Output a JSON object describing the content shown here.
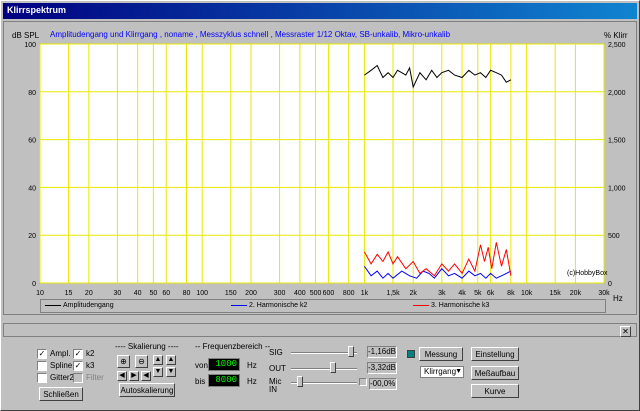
{
  "window": {
    "title": "Klirrspektrum"
  },
  "plot": {
    "subtitle": "Amplitudengang und Klirrgang , noname , Messzyklus schnell , Messraster 1/12 Oktav, SB-unkalib, Mikro-unkalib",
    "left_unit": "dB SPL",
    "right_unit": "% Klirr",
    "x_unit": "Hz",
    "watermark": "(c)HobbyBox"
  },
  "chart_data": {
    "type": "line",
    "xscale": "log",
    "xlim": [
      10,
      30000
    ],
    "ylim_left": [
      0,
      100
    ],
    "ylim_right": [
      0,
      2500
    ],
    "grid": true,
    "x_ticks": [
      "10",
      "15",
      "20",
      "30",
      "40",
      "50",
      "60",
      "80",
      "100",
      "150",
      "200",
      "300",
      "400",
      "500",
      "600",
      "800",
      "1k",
      "1,5k",
      "2k",
      "3k",
      "4k",
      "5k",
      "6k",
      "8k",
      "10k",
      "15k",
      "20k",
      "30k"
    ],
    "y_left_ticks": [
      "0",
      "20",
      "40",
      "60",
      "80",
      "100"
    ],
    "y_right_ticks": [
      "0",
      "500",
      "1,000",
      "1,500",
      "2,000",
      "2,500"
    ],
    "series": [
      {
        "name": "Amplitudengang",
        "color": "#000000",
        "x": [
          1000,
          1100,
          1200,
          1300,
          1400,
          1500,
          1600,
          1700,
          1800,
          1900,
          2000,
          2200,
          2400,
          2600,
          2800,
          3000,
          3300,
          3600,
          4000,
          4400,
          4800,
          5200,
          5600,
          6000,
          6500,
          7000,
          7500,
          8000
        ],
        "y": [
          87,
          89,
          91,
          86,
          88,
          86,
          89,
          88,
          87,
          90,
          82,
          88,
          85,
          89,
          86,
          88,
          89,
          87,
          86,
          89,
          87,
          88,
          86,
          89,
          88,
          87,
          84,
          85
        ]
      },
      {
        "name": "2. Harmonische k2",
        "color": "#0000ff",
        "x": [
          1000,
          1100,
          1200,
          1300,
          1400,
          1500,
          1700,
          1900,
          2100,
          2300,
          2500,
          2700,
          3000,
          3300,
          3600,
          4000,
          4400,
          4800,
          5200,
          5600,
          6000,
          6500,
          7000,
          7500,
          8000
        ],
        "y": [
          7,
          3,
          5,
          2,
          4,
          2,
          5,
          3,
          2,
          5,
          4,
          2,
          6,
          3,
          4,
          2,
          5,
          3,
          4,
          2,
          4,
          2,
          3,
          4,
          5
        ]
      },
      {
        "name": "3. Harmonische k3",
        "color": "#ff0000",
        "x": [
          1000,
          1100,
          1200,
          1300,
          1400,
          1500,
          1600,
          1800,
          2000,
          2200,
          2400,
          2700,
          3000,
          3300,
          3600,
          4000,
          4400,
          4800,
          5200,
          5500,
          5800,
          6100,
          6500,
          7000,
          7500,
          8000
        ],
        "y": [
          13,
          8,
          12,
          9,
          13,
          8,
          11,
          6,
          9,
          4,
          6,
          3,
          8,
          5,
          8,
          4,
          10,
          5,
          16,
          9,
          15,
          6,
          17,
          7,
          14,
          3
        ]
      }
    ]
  },
  "bottom": {
    "checkboxes": [
      {
        "label": "Ampl.",
        "checked": true
      },
      {
        "label": "k2",
        "checked": true
      },
      {
        "label": "Spline",
        "checked": false
      },
      {
        "label": "k3",
        "checked": true
      },
      {
        "label": "Gitter2",
        "checked": false
      },
      {
        "label": "Filter",
        "checked": false
      }
    ],
    "close_button": "Schließen",
    "scaling_group": "Skalierung",
    "autoscale_button": "Autoskalierung",
    "freq_group": "Frequenzbereich",
    "from_label": "von",
    "to_label": "bis",
    "from_value": "1000",
    "to_value": "8000",
    "hz": "Hz",
    "sig_label": "SIG",
    "out_label": "OUT",
    "mic_label": "Mic IN",
    "sig_value": "-1,16dB",
    "out_value": "-3,32dB",
    "mic_value": "-00,0%",
    "measure_button": "Messung",
    "mode_select": "Klirrgang",
    "settings_button": "Einstellung",
    "structure_button": "Meßaufbau",
    "curve_button": "Kurve",
    "sig_level": 0.95,
    "out_level": 0.65,
    "mic_level": 0.1
  }
}
